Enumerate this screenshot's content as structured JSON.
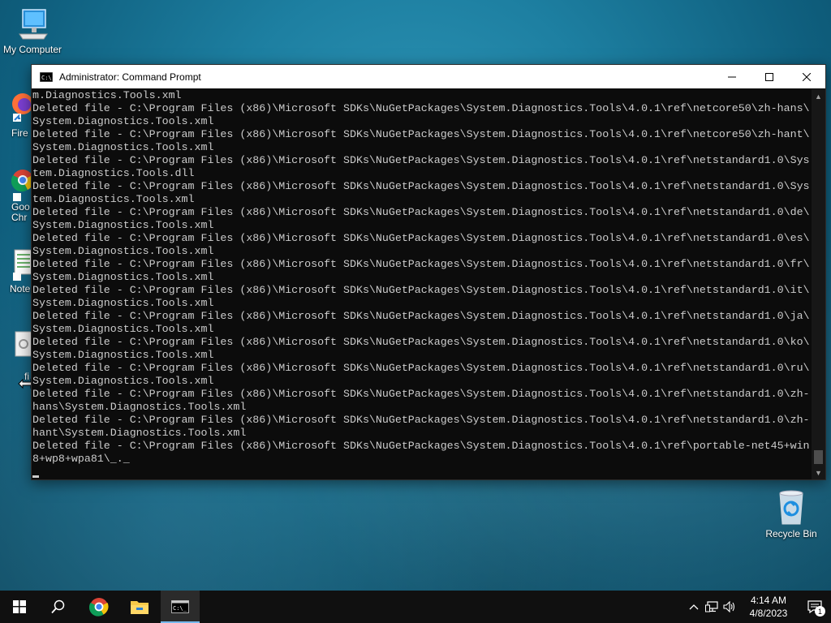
{
  "desktop": {
    "icons": [
      {
        "label": "My Computer"
      },
      {
        "label": "Fire"
      },
      {
        "label": "Goo\nChr"
      },
      {
        "label": "Notep"
      },
      {
        "label": "fi"
      }
    ],
    "recycle_bin": {
      "label": "Recycle Bin"
    }
  },
  "window": {
    "title": "Administrator: Command Prompt",
    "console_lines": [
      "m.Diagnostics.Tools.xml",
      "Deleted file - C:\\Program Files (x86)\\Microsoft SDKs\\NuGetPackages\\System.Diagnostics.Tools\\4.0.1\\ref\\netcore50\\zh-hans\\",
      "System.Diagnostics.Tools.xml",
      "Deleted file - C:\\Program Files (x86)\\Microsoft SDKs\\NuGetPackages\\System.Diagnostics.Tools\\4.0.1\\ref\\netcore50\\zh-hant\\",
      "System.Diagnostics.Tools.xml",
      "Deleted file - C:\\Program Files (x86)\\Microsoft SDKs\\NuGetPackages\\System.Diagnostics.Tools\\4.0.1\\ref\\netstandard1.0\\Sys",
      "tem.Diagnostics.Tools.dll",
      "Deleted file - C:\\Program Files (x86)\\Microsoft SDKs\\NuGetPackages\\System.Diagnostics.Tools\\4.0.1\\ref\\netstandard1.0\\Sys",
      "tem.Diagnostics.Tools.xml",
      "Deleted file - C:\\Program Files (x86)\\Microsoft SDKs\\NuGetPackages\\System.Diagnostics.Tools\\4.0.1\\ref\\netstandard1.0\\de\\",
      "System.Diagnostics.Tools.xml",
      "Deleted file - C:\\Program Files (x86)\\Microsoft SDKs\\NuGetPackages\\System.Diagnostics.Tools\\4.0.1\\ref\\netstandard1.0\\es\\",
      "System.Diagnostics.Tools.xml",
      "Deleted file - C:\\Program Files (x86)\\Microsoft SDKs\\NuGetPackages\\System.Diagnostics.Tools\\4.0.1\\ref\\netstandard1.0\\fr\\",
      "System.Diagnostics.Tools.xml",
      "Deleted file - C:\\Program Files (x86)\\Microsoft SDKs\\NuGetPackages\\System.Diagnostics.Tools\\4.0.1\\ref\\netstandard1.0\\it\\",
      "System.Diagnostics.Tools.xml",
      "Deleted file - C:\\Program Files (x86)\\Microsoft SDKs\\NuGetPackages\\System.Diagnostics.Tools\\4.0.1\\ref\\netstandard1.0\\ja\\",
      "System.Diagnostics.Tools.xml",
      "Deleted file - C:\\Program Files (x86)\\Microsoft SDKs\\NuGetPackages\\System.Diagnostics.Tools\\4.0.1\\ref\\netstandard1.0\\ko\\",
      "System.Diagnostics.Tools.xml",
      "Deleted file - C:\\Program Files (x86)\\Microsoft SDKs\\NuGetPackages\\System.Diagnostics.Tools\\4.0.1\\ref\\netstandard1.0\\ru\\",
      "System.Diagnostics.Tools.xml",
      "Deleted file - C:\\Program Files (x86)\\Microsoft SDKs\\NuGetPackages\\System.Diagnostics.Tools\\4.0.1\\ref\\netstandard1.0\\zh-",
      "hans\\System.Diagnostics.Tools.xml",
      "Deleted file - C:\\Program Files (x86)\\Microsoft SDKs\\NuGetPackages\\System.Diagnostics.Tools\\4.0.1\\ref\\netstandard1.0\\zh-",
      "hant\\System.Diagnostics.Tools.xml",
      "Deleted file - C:\\Program Files (x86)\\Microsoft SDKs\\NuGetPackages\\System.Diagnostics.Tools\\4.0.1\\ref\\portable-net45+win",
      "8+wp8+wpa81\\_._"
    ],
    "controls": [
      "minimize-icon",
      "maximize-icon",
      "close-icon"
    ]
  },
  "taskbar": {
    "buttons": [
      "windows-start-icon",
      "search-icon",
      "chrome-icon",
      "file-explorer-icon",
      "command-prompt-icon"
    ],
    "clock": {
      "time": "4:14 AM",
      "date": "4/8/2023"
    },
    "notification_count": "1"
  },
  "colors": {
    "console_bg": "#0c0c0c",
    "console_text": "#cccccc",
    "taskbar_bg": "#101010",
    "active_indicator": "#76b9ed"
  }
}
